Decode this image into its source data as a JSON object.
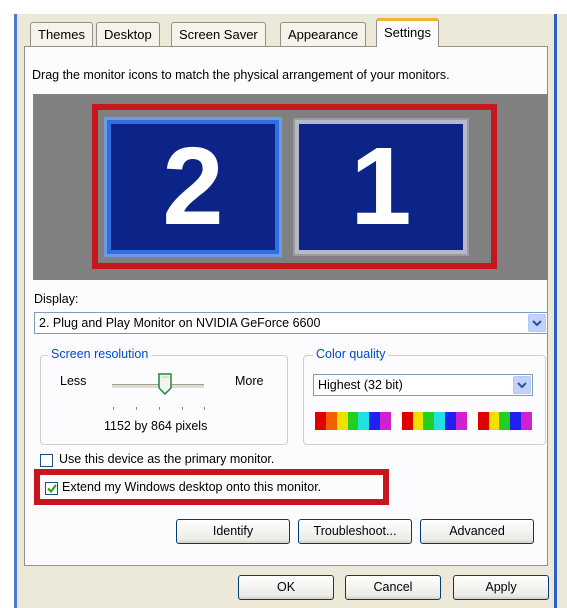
{
  "tabs": [
    "Themes",
    "Desktop",
    "Screen Saver",
    "Appearance",
    "Settings"
  ],
  "active_tab": "Settings",
  "instructions": "Drag the monitor icons to match the physical arrangement of your monitors.",
  "monitors": [
    {
      "number": "2",
      "selected": true
    },
    {
      "number": "1",
      "selected": false
    }
  ],
  "display": {
    "label": "Display:",
    "value": "2. Plug and Play Monitor on NVIDIA GeForce 6600"
  },
  "resolution": {
    "title": "Screen resolution",
    "less_label": "Less",
    "more_label": "More",
    "value": "1152 by 864 pixels",
    "slider_level": 0.5
  },
  "color_quality": {
    "title": "Color quality",
    "value": "Highest (32 bit)",
    "bar_colors": [
      "#e00000",
      "#f06000",
      "#f0e000",
      "#20d020",
      "#20e0e0",
      "#2020f0",
      "#d020d0",
      "#ffffff",
      "#e00000",
      "#f0e000",
      "#20d020",
      "#20e0e0",
      "#2020f0",
      "#d020d0",
      "#ffffff",
      "#e00000",
      "#f0e000",
      "#20d020",
      "#2020f0",
      "#d020d0"
    ]
  },
  "options": {
    "primary_label": "Use this device as the primary monitor.",
    "primary_checked": false,
    "extend_label": "Extend my Windows desktop onto this monitor.",
    "extend_checked": true
  },
  "buttons": {
    "identify": "Identify",
    "troubleshoot": "Troubleshoot...",
    "advanced": "Advanced",
    "ok": "OK",
    "cancel": "Cancel",
    "apply": "Apply"
  },
  "highlight_color": "#c8161e"
}
